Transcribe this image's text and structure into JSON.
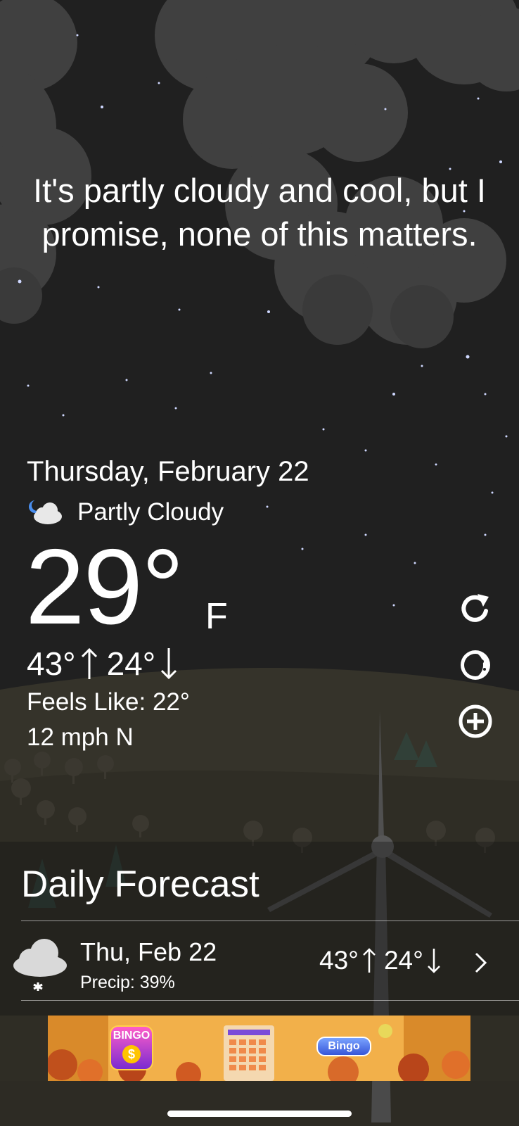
{
  "headline": "It's partly cloudy and cool, but I promise, none of this matters.",
  "current": {
    "date": "Thursday, February 22",
    "condition_icon": "night-partly-cloudy-icon",
    "condition": "Partly Cloudy",
    "temperature": "29°",
    "unit": "F",
    "high": "43°",
    "low": "24°",
    "feels_like": "Feels Like: 22°",
    "wind": "12 mph N"
  },
  "controls": [
    {
      "name": "refresh-button",
      "icon": "refresh-icon"
    },
    {
      "name": "moon-phase-button",
      "icon": "moon-icon"
    },
    {
      "name": "add-location-button",
      "icon": "plus-circle-icon"
    }
  ],
  "daily_forecast": {
    "title": "Daily Forecast",
    "rows": [
      {
        "icon": "snow-cloud-icon",
        "date": "Thu, Feb 22",
        "precip": "Precip: 39%",
        "high": "43°",
        "low": "24°"
      }
    ]
  },
  "ad": {
    "logo_text": "BINGO",
    "coin_symbol": "$",
    "button_label": "Bingo"
  },
  "colors": {
    "sky": "#202020",
    "hill": "#35332a",
    "foreground": "#2c2a22",
    "cloud": "#4a4a4a",
    "text": "#ffffff"
  }
}
